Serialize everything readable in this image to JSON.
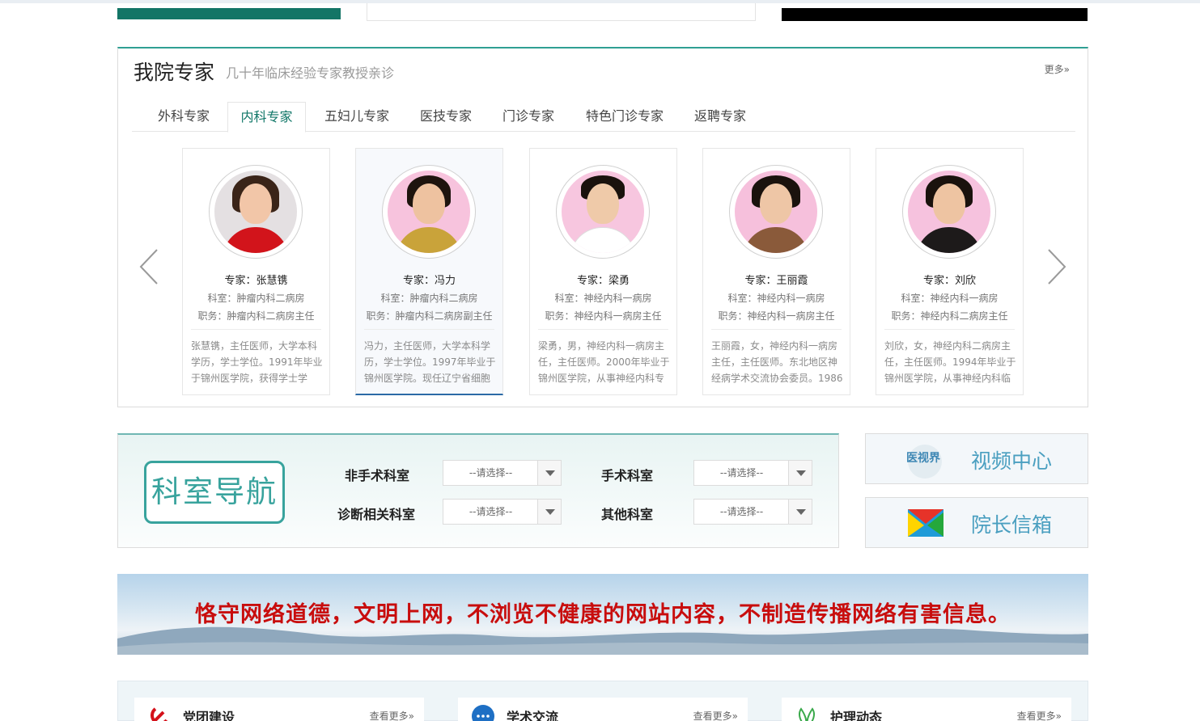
{
  "experts": {
    "title": "我院专家",
    "subtitle": "几十年临床经验专家教授亲诊",
    "more": "更多»",
    "tabs": [
      {
        "label": "外科专家"
      },
      {
        "label": "内科专家"
      },
      {
        "label": "五妇儿专家"
      },
      {
        "label": "医技专家"
      },
      {
        "label": "门诊专家"
      },
      {
        "label": "特色门诊专家"
      },
      {
        "label": "返聘专家"
      }
    ],
    "active_tab": "内科专家",
    "cards": [
      {
        "name": "专家：张慧镌",
        "dept": "科室：肿瘤内科二病房",
        "position": "职务：肿瘤内科二病房主任",
        "desc": "张慧镌，主任医师，大学本科学历，学士学位。1991年毕业于锦州医学院，获得学士学"
      },
      {
        "name": "专家：冯力",
        "dept": "科室：肿瘤内科二病房",
        "position": "职务：肿瘤内科二病房副主任",
        "desc": "冯力，主任医师，大学本科学历，学士学位。1997年毕业于锦州医学院。现任辽宁省细胞"
      },
      {
        "name": "专家：梁勇",
        "dept": "科室：神经内科一病房",
        "position": "职务：神经内科一病房主任",
        "desc": "梁勇，男，神经内科一病房主任，主任医师。2000年毕业于锦州医学院，从事神经内科专"
      },
      {
        "name": "专家：王丽霞",
        "dept": "科室：神经内科一病房",
        "position": "职务：神经内科一病房主任",
        "desc": "王丽霞，女，神经内科一病房主任，主任医师。东北地区神经病学术交流协会委员。1986"
      },
      {
        "name": "专家：刘欣",
        "dept": "科室：神经内科一病房",
        "position": "职务：神经内科二病房主任",
        "desc": "刘欣，女，神经内科二病房主任，主任医师。1994年毕业于锦州医学院，从事神经内科临"
      }
    ]
  },
  "dept_nav": {
    "logo_text": "科室导航",
    "fields": [
      {
        "label": "非手术科室",
        "value": "--请选择--"
      },
      {
        "label": "手术科室",
        "value": "--请选择--"
      },
      {
        "label": "诊断相关科室",
        "value": "--请选择--"
      },
      {
        "label": "其他科室",
        "value": "--请选择--"
      }
    ]
  },
  "side": {
    "video": "视频中心",
    "video_icon_text": "医视界",
    "mailbox": "院长信箱"
  },
  "banner": {
    "text": "恪守网络道德，文明上网，不浏览不健康的网站内容，不制造传播网络有害信息。"
  },
  "bottom": [
    {
      "title": "党团建设",
      "more": "查看更多»",
      "icon": "party-icon"
    },
    {
      "title": "学术交流",
      "more": "查看更多»",
      "icon": "chat-bubble-icon"
    },
    {
      "title": "护理动态",
      "more": "查看更多»",
      "icon": "leaf-icon"
    }
  ],
  "colors": {
    "brand_green": "#137566",
    "teal": "#38a39d",
    "banner_red": "#c80d0d",
    "side_blue": "#4a9fc0"
  }
}
